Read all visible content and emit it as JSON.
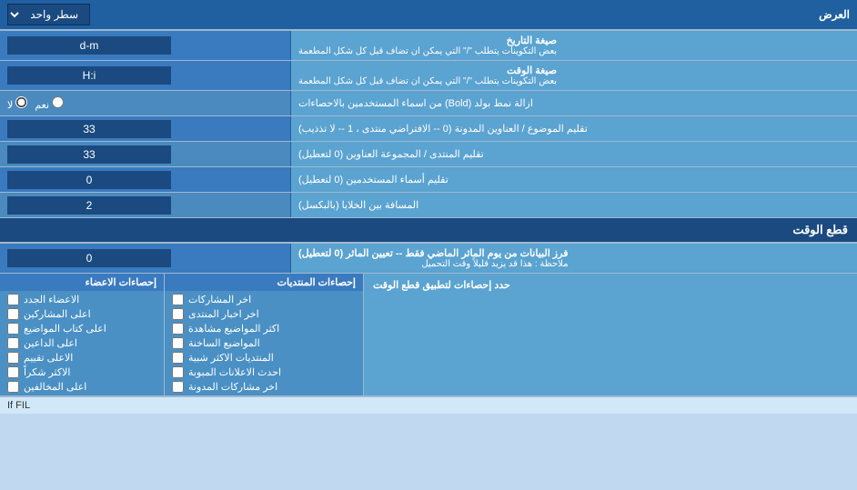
{
  "header": {
    "title": "العرض",
    "dropdown_label": "سطر واحد"
  },
  "rows": [
    {
      "id": "date_format",
      "label_main": "صيغة التاريخ",
      "label_sub": "بعض التكوينات يتطلب \"/\" التي يمكن ان تضاف قبل كل شكل المطعمة",
      "input_value": "d-m",
      "type": "input"
    },
    {
      "id": "time_format",
      "label_main": "صيغة الوقت",
      "label_sub": "بعض التكوينات يتطلب \"/\" التي يمكن ان تضاف قبل كل شكل المطعمة",
      "input_value": "H:i",
      "type": "input"
    },
    {
      "id": "bold_remove",
      "label": "ازالة نمط بولد (Bold) من اسماء المستخدمين بالاحصاءات",
      "radio_yes": "نعم",
      "radio_no": "لا",
      "selected": "no",
      "type": "radio"
    },
    {
      "id": "topics_titles",
      "label": "تقليم الموضوع / العناوين المدونة (0 -- الافتراضي منتدى ، 1 -- لا تذذيب)",
      "input_value": "33",
      "type": "input"
    },
    {
      "id": "forum_groups",
      "label": "تقليم المنتدى / المجموعة العناوين (0 لتعطيل)",
      "input_value": "33",
      "type": "input"
    },
    {
      "id": "usernames_trim",
      "label": "تقليم أسماء المستخدمين (0 لتعطيل)",
      "input_value": "0",
      "type": "input"
    },
    {
      "id": "cell_spacing",
      "label": "المسافة بين الخلايا (بالبكسل)",
      "input_value": "2",
      "type": "input"
    }
  ],
  "cutoff_section": {
    "title": "قطع الوقت",
    "row": {
      "label_main": "فرز البيانات من يوم الماثر الماضي فقط -- تعيين الماثر (0 لتعطيل)",
      "label_note": "ملاحظة : هذا قد يزيد قليلاً وقت التحميل",
      "input_value": "0"
    },
    "apply_label": "حدد إحصاءات لتطبيق قطع الوقت"
  },
  "checkboxes": {
    "col_left": {
      "header": "إحصاءات الاعضاء",
      "items": [
        "الاعضاء الجدد",
        "اعلى المشاركين",
        "اعلى كتاب المواضيع",
        "اعلى الداعين",
        "الاعلى تقييم",
        "الاكثر شكراً",
        "اعلى المخالفين"
      ]
    },
    "col_mid": {
      "header": "إحصاءات المنتديات",
      "items": [
        "اخر المشاركات",
        "اخر اخبار المنتدى",
        "اكثر المواضيع مشاهدة",
        "المواضيع الساخنة",
        "المنتديات الاكثر شبية",
        "احدث الاعلانات المبوبة",
        "اخر مشاركات المدونة"
      ]
    },
    "col_right": {
      "header": "",
      "apply_text": "حدد إحصاءات لتطبيق قطع الوقت"
    }
  },
  "bottom_text": "If FIL"
}
